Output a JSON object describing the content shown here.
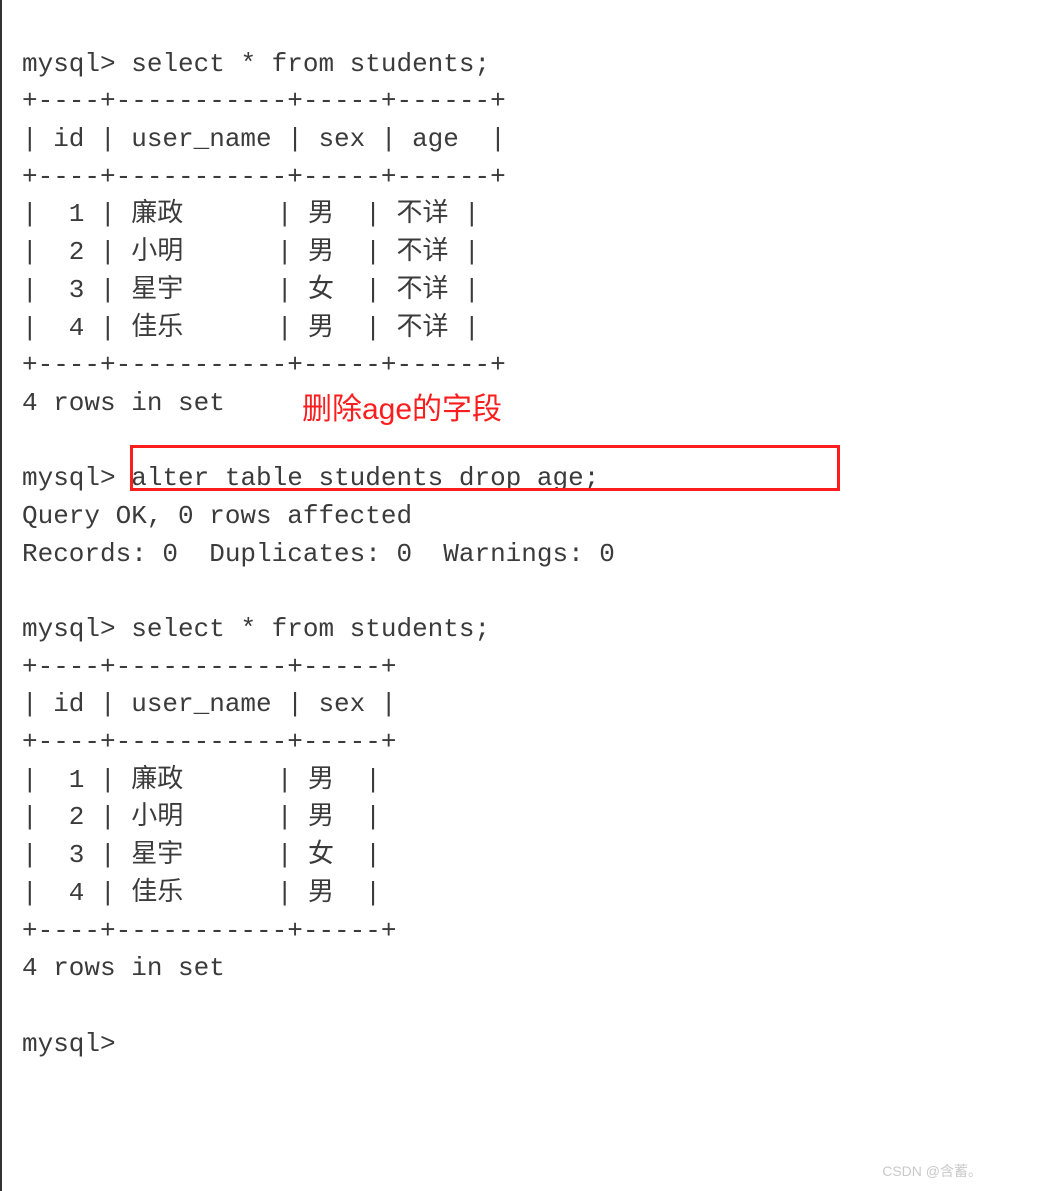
{
  "prompt": "mysql>",
  "query1": {
    "sql": "select * from students;",
    "border_top": "+----+-----------+-----+------+",
    "header": "| id | user_name | sex | age  |",
    "border_mid": "+----+-----------+-----+------+",
    "rows": [
      "|  1 | 廉政      | 男  | 不详 |",
      "|  2 | 小明      | 男  | 不详 |",
      "|  3 | 星宇      | 女  | 不详 |",
      "|  4 | 佳乐      | 男  | 不详 |"
    ],
    "border_bot": "+----+-----------+-----+------+",
    "summary": "4 rows in set"
  },
  "annotation_text": "删除age的字段",
  "alter": {
    "sql": "alter table students drop age;",
    "result1": "Query OK, 0 rows affected",
    "result2": "Records: 0  Duplicates: 0  Warnings: 0"
  },
  "query2": {
    "sql": "select * from students;",
    "border_top": "+----+-----------+-----+",
    "header": "| id | user_name | sex |",
    "border_mid": "+----+-----------+-----+",
    "rows": [
      "|  1 | 廉政      | 男  |",
      "|  2 | 小明      | 男  |",
      "|  3 | 星宇      | 女  |",
      "|  4 | 佳乐      | 男  |"
    ],
    "border_bot": "+----+-----------+-----+",
    "summary": "4 rows in set"
  },
  "watermark": "CSDN @含蓄。"
}
